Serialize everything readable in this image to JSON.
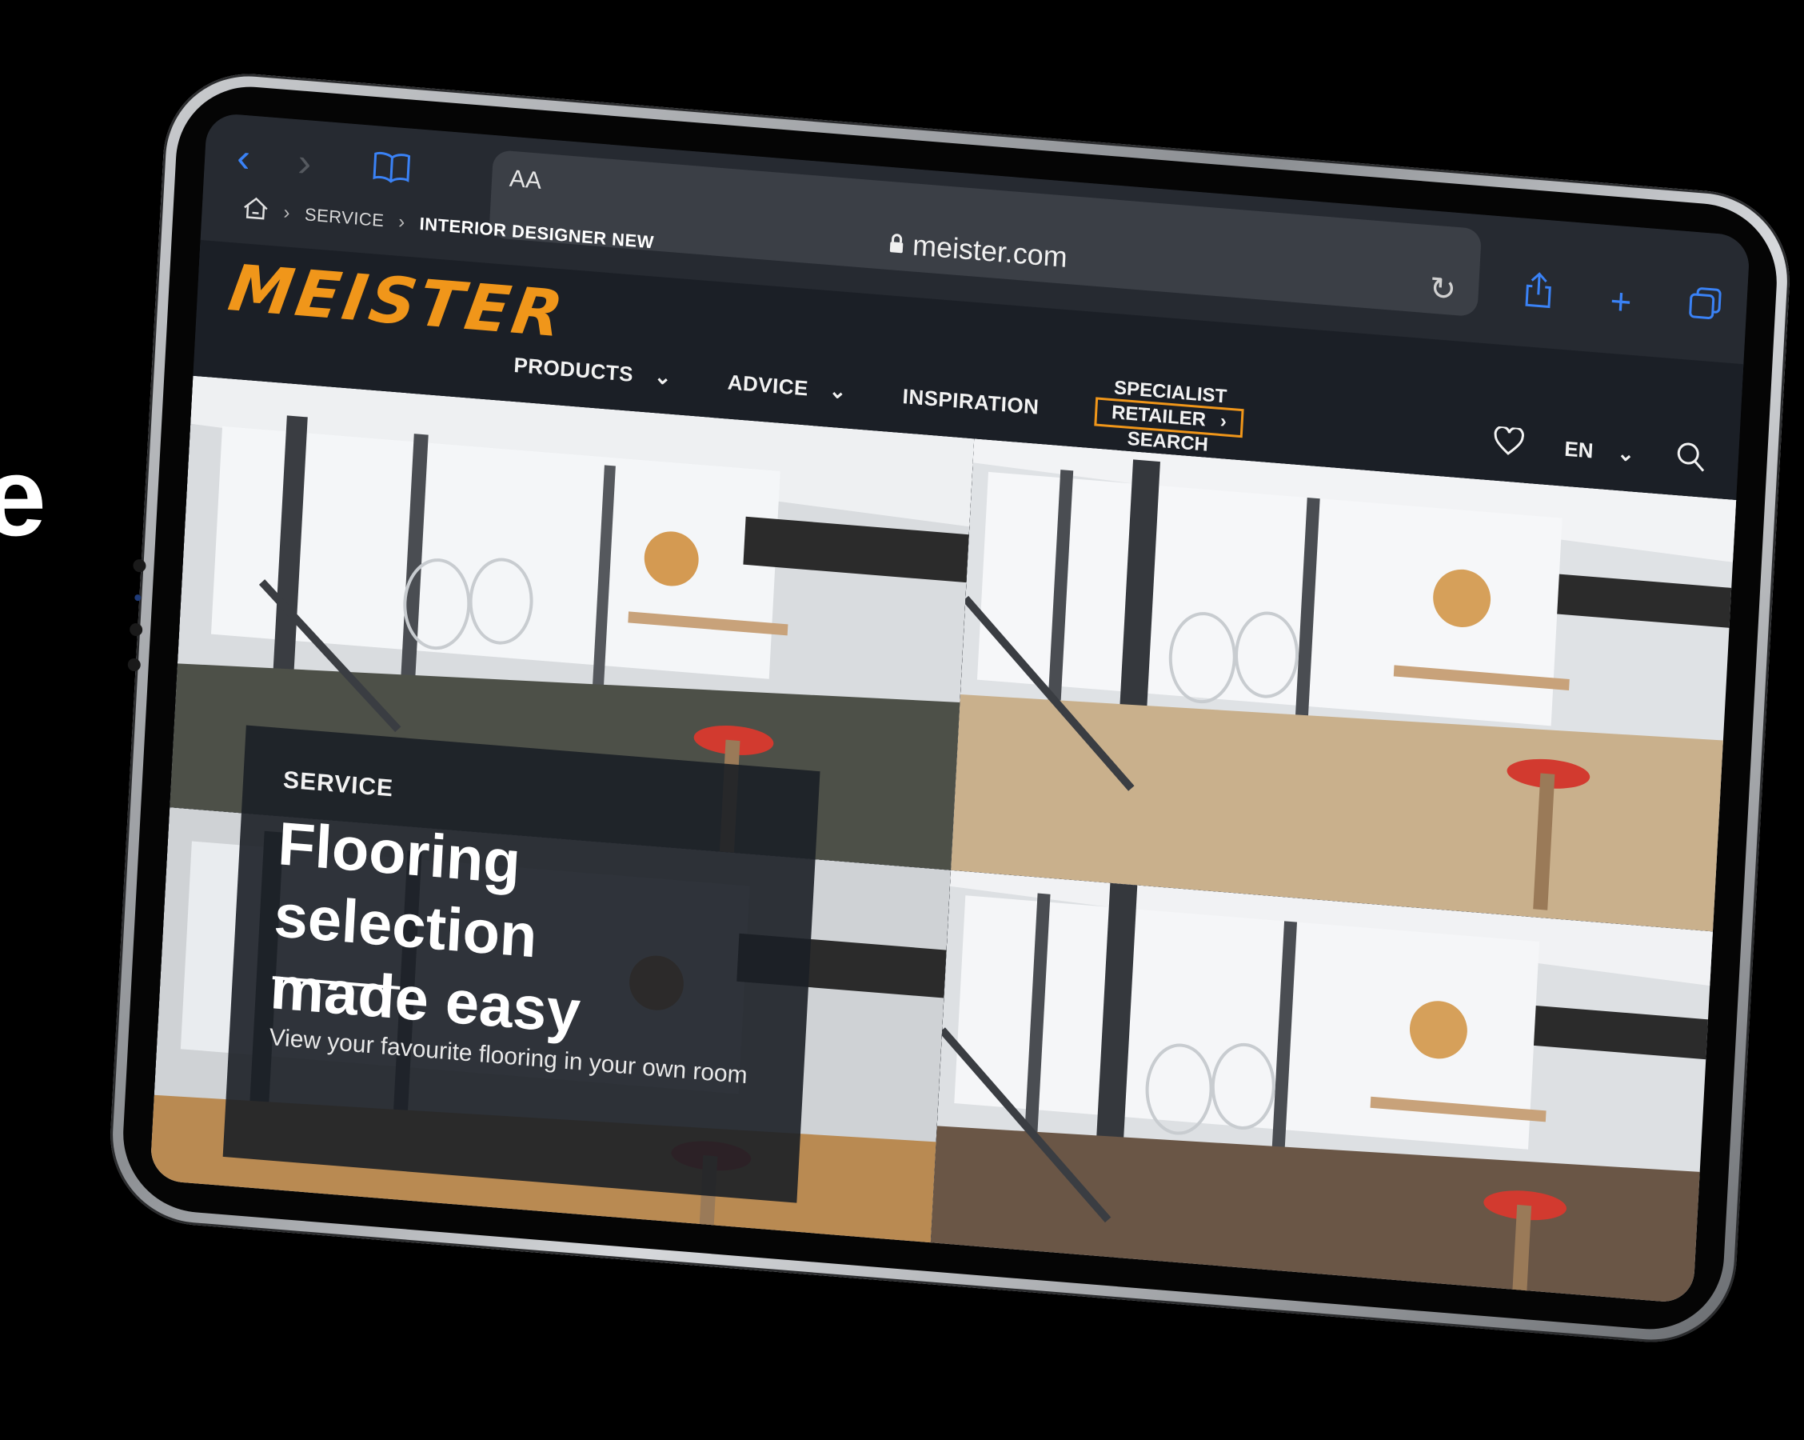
{
  "edge_letter": "e",
  "browser": {
    "text_size_label": "AA",
    "url": "meister.com"
  },
  "breadcrumb": {
    "level1": "SERVICE",
    "level2": "INTERIOR DESIGNER NEW"
  },
  "site": {
    "logo": "MEISTER",
    "nav": {
      "products": "PRODUCTS",
      "advice": "ADVICE",
      "inspiration": "INSPIRATION",
      "specialist_line1": "SPECIALIST",
      "specialist_line2": "RETAILER",
      "specialist_line3": "SEARCH"
    },
    "language": "EN"
  },
  "hero": {
    "kicker": "SERVICE",
    "headline_line1": "Flooring selection",
    "headline_line2": "made easy",
    "subtitle": "View your favourite flooring in your own room"
  },
  "colors": {
    "brand_orange": "#f0961a",
    "header_bg": "#1b1f26",
    "safari_blue": "#3a82f6"
  },
  "icons": {
    "back": "chevron-left-icon",
    "forward": "chevron-right-icon",
    "bookmarks": "book-icon",
    "lock": "lock-icon",
    "reload": "reload-icon",
    "share": "share-icon",
    "new_tab": "plus-icon",
    "tabs": "tabs-icon",
    "home": "home-icon",
    "favourites": "heart-icon",
    "search": "search-icon"
  }
}
